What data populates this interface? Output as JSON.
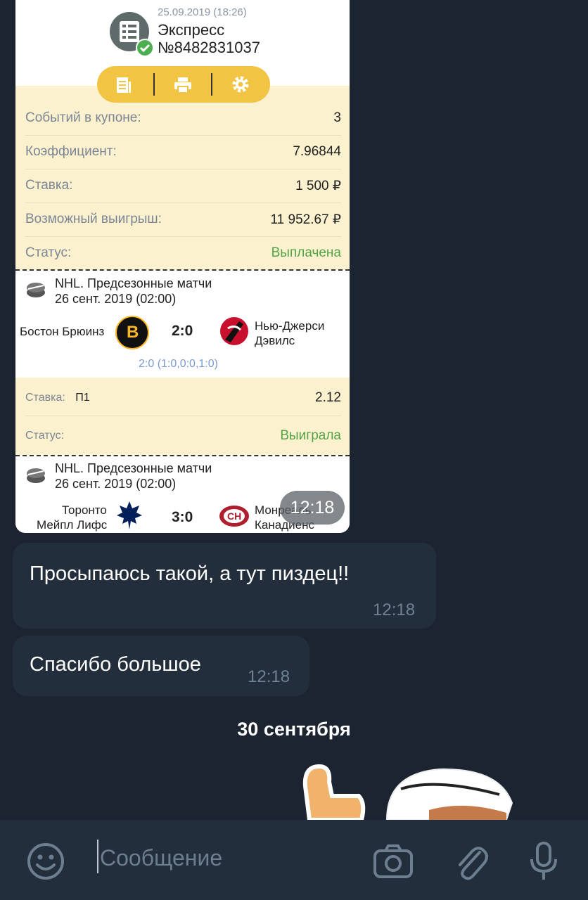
{
  "coupon": {
    "date": "25.09.2019 (18:26)",
    "title": "Экспресс",
    "number": "№8482831037",
    "summary_rows": [
      {
        "label": "Событий в купоне:",
        "value": "3"
      },
      {
        "label": "Коэффициент:",
        "value": "7.96844"
      },
      {
        "label": "Ставка:",
        "value": "1 500 ₽"
      },
      {
        "label": "Возможный выигрыш:",
        "value": "11 952.67 ₽"
      },
      {
        "label": "Статус:",
        "value": "Выплачена"
      }
    ],
    "events": [
      {
        "league": "NHL. Предсезонные матчи",
        "datetime": "26 сент. 2019 (02:00)",
        "home": "Бостон Брюинз",
        "away_line1": "Нью-Джерси",
        "away_line2": "Дэвилс",
        "score": "2:0",
        "periods": "2:0 (1:0,0:0,1:0)",
        "bet_label": "Ставка:",
        "bet_pick": "П1",
        "bet_odds": "2.12",
        "status_label": "Статус:",
        "status_value": "Выиграла"
      },
      {
        "league": "NHL. Предсезонные матчи",
        "datetime": "26 сент. 2019 (02:00)",
        "home_line1": "Торонто",
        "home_line2": "Мейпл Лифс",
        "away_line1": "Монреаль",
        "away_line2": "Канадиенс",
        "score": "3:0"
      }
    ],
    "image_time": "12:18"
  },
  "messages": [
    {
      "text": "Просыпаюсь такой, а тут пиздец!!",
      "time": "12:18"
    },
    {
      "text": "Спасибо большое",
      "time": "12:18"
    }
  ],
  "date_separator": "30 сентября",
  "composer": {
    "placeholder": "Сообщение"
  },
  "colors": {
    "background": "#1b2430",
    "bubble": "#232e3c",
    "coupon_yellow": "#fcf1cf",
    "toolbar": "#f2c444",
    "status_green": "#52a447"
  }
}
